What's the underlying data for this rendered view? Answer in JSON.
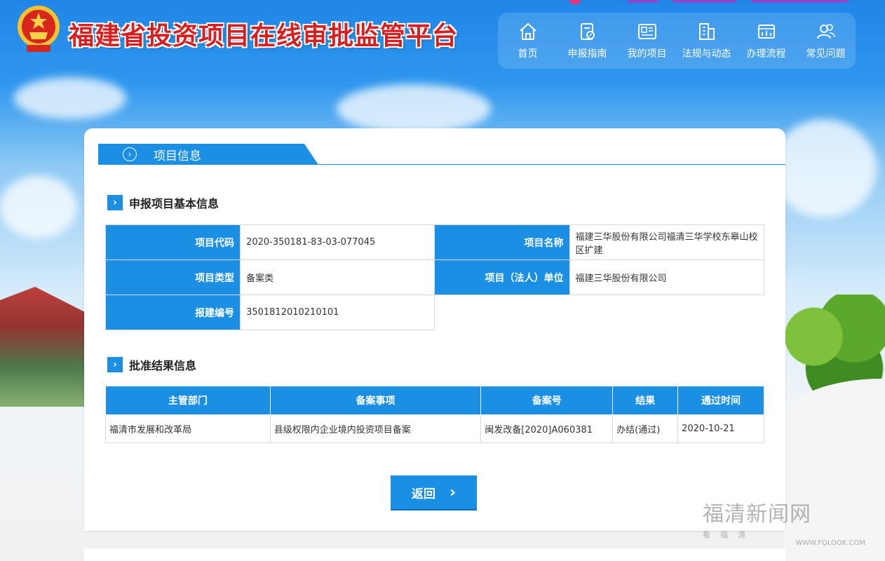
{
  "header": {
    "title": "福建省投资项目在线审批监管平台",
    "nav": [
      {
        "label": "首页",
        "icon": "home-icon"
      },
      {
        "label": "申报指南",
        "icon": "guide-icon"
      },
      {
        "label": "我的项目",
        "icon": "project-icon"
      },
      {
        "label": "法规与动态",
        "icon": "building-icon"
      },
      {
        "label": "办理流程",
        "icon": "flow-icon"
      },
      {
        "label": "常见问题",
        "icon": "users-icon"
      }
    ]
  },
  "panel": {
    "tab_label": "项目信息",
    "basic": {
      "section_title": "申报项目基本信息",
      "rows": [
        {
          "l1": "项目代码",
          "v1": "2020-350181-83-03-077045",
          "l2": "项目名称",
          "v2": "福建三华股份有限公司福清三华学校东皋山校区扩建"
        },
        {
          "l1": "项目类型",
          "v1": "备案类",
          "l2": "项目（法人）单位",
          "v2": "福建三华股份有限公司"
        },
        {
          "l1": "报建编号",
          "v1": "3501812010210101"
        }
      ]
    },
    "result": {
      "section_title": "批准结果信息",
      "headers": [
        "主管部门",
        "备案事项",
        "备案号",
        "结果",
        "通过时间"
      ],
      "rows": [
        [
          "福清市发展和改革局",
          "县级权限内企业境内投资项目备案",
          "闽发改备[2020]A060381",
          "办结(通过)",
          "2020-10-21"
        ]
      ]
    },
    "back_label": "返回"
  },
  "watermark": {
    "main": "福清新闻网",
    "sub": "看福清",
    "url": "WWW.FQLOOK.COM"
  }
}
